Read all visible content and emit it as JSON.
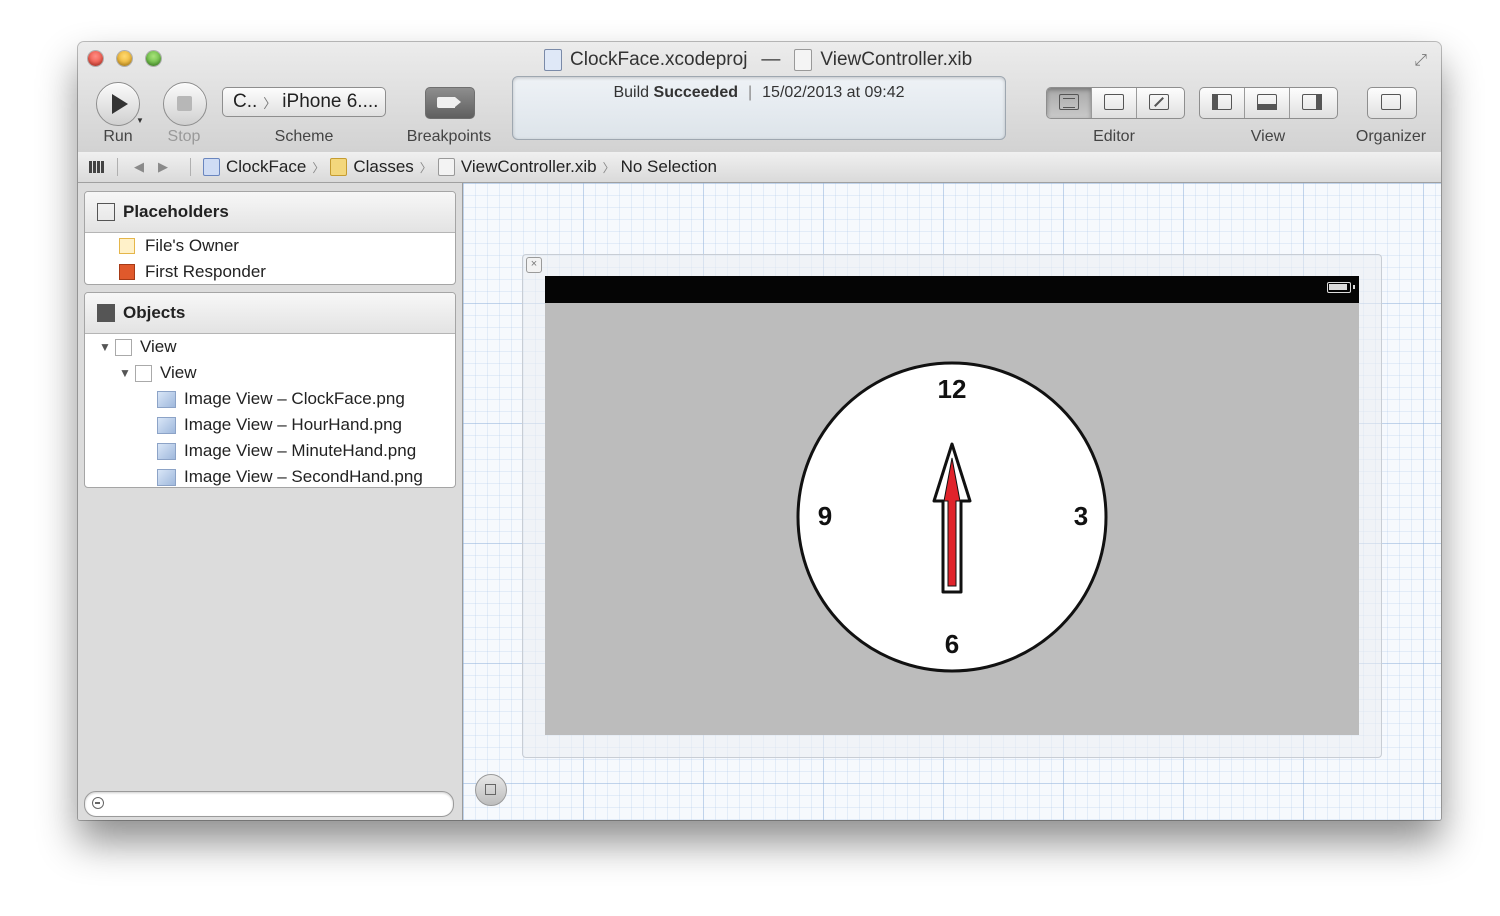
{
  "window": {
    "title_project": "ClockFace.xcodeproj",
    "title_separator": "—",
    "title_file": "ViewController.xib"
  },
  "toolbar": {
    "run_label": "Run",
    "stop_label": "Stop",
    "scheme_target": "C..",
    "scheme_device": "iPhone 6....",
    "scheme_label": "Scheme",
    "breakpoints_label": "Breakpoints",
    "editor_label": "Editor",
    "view_label": "View",
    "organizer_label": "Organizer"
  },
  "status": {
    "prefix": "Build",
    "state": "Succeeded",
    "timestamp": "15/02/2013 at 09:42"
  },
  "jumpbar": {
    "crumbs": [
      "ClockFace",
      "Classes",
      "ViewController.xib",
      "No Selection"
    ]
  },
  "placeholders": {
    "title": "Placeholders",
    "items": [
      "File's Owner",
      "First Responder"
    ]
  },
  "objects": {
    "title": "Objects",
    "root": "View",
    "child": "View",
    "images": [
      "Image View – ClockFace.png",
      "Image View – HourHand.png",
      "Image View – MinuteHand.png",
      "Image View – SecondHand.png"
    ]
  },
  "clock": {
    "numerals": [
      "12",
      "3",
      "6",
      "9"
    ],
    "hand_color": "#e0232b"
  },
  "icons": {
    "run": "play-icon",
    "stop": "stop-icon",
    "breakpoints": "breakpoint-arrow-icon",
    "placeholders": "cube-outline-icon",
    "objects": "cube-solid-icon"
  }
}
